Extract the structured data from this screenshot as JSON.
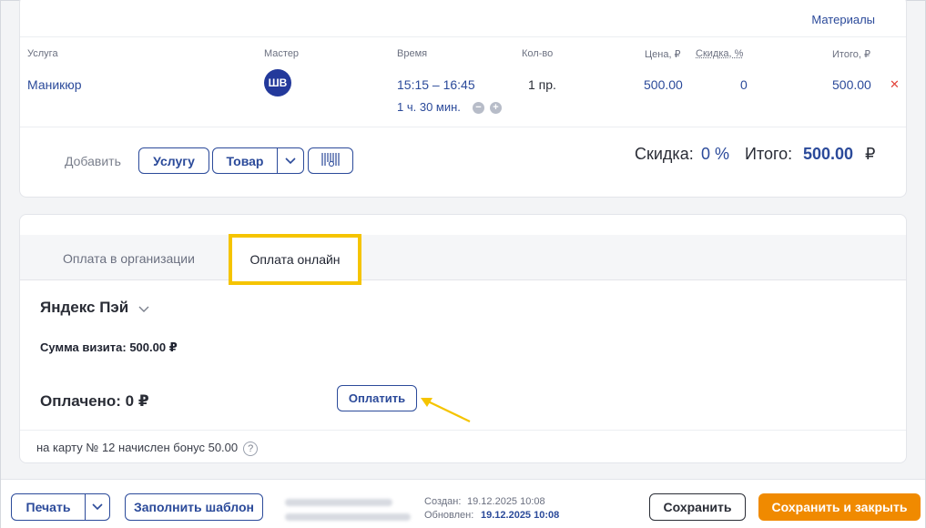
{
  "services": {
    "materials_link": "Материалы",
    "columns": {
      "service": "Услуга",
      "master": "Мастер",
      "time": "Время",
      "qty": "Кол-во",
      "price": "Цена, ₽",
      "discount": "Скидка, %",
      "total": "Итого, ₽"
    },
    "rows": [
      {
        "service": "Маникюр",
        "master_initials": "ШВ",
        "time_range": "15:15 – 16:45",
        "duration": "1 ч. 30 мин.",
        "qty": "1 пр.",
        "price": "500.00",
        "discount": "0",
        "total": "500.00"
      }
    ],
    "add_label": "Добавить",
    "add_service_button": "Услугу",
    "add_product_button": "Товар",
    "summary": {
      "discount_label": "Скидка:",
      "discount_value": "0 %",
      "total_label": "Итого:",
      "total_value": "500.00",
      "currency": "₽"
    }
  },
  "payment": {
    "tabs": [
      "Оплата в организации",
      "Оплата онлайн"
    ],
    "active_tab": "Оплата онлайн",
    "provider": "Яндекс Пэй",
    "visit_sum": "Сумма визита: 500.00 ₽",
    "paid": "Оплачено: 0 ₽",
    "pay_button": "Оплатить",
    "bonus_note": "на карту № 12 начислен бонус 50.00",
    "highlight_color": "#f5c400"
  },
  "footer": {
    "print_button": "Печать",
    "template_button": "Заполнить шаблон",
    "created_label": "Создан:",
    "created_value": "19.12.2025 10:08",
    "updated_label": "Обновлен:",
    "updated_value": "19.12.2025 10:08",
    "save_button": "Сохранить",
    "save_close_button": "Сохранить и закрыть",
    "accent_color": "#f08a00"
  }
}
